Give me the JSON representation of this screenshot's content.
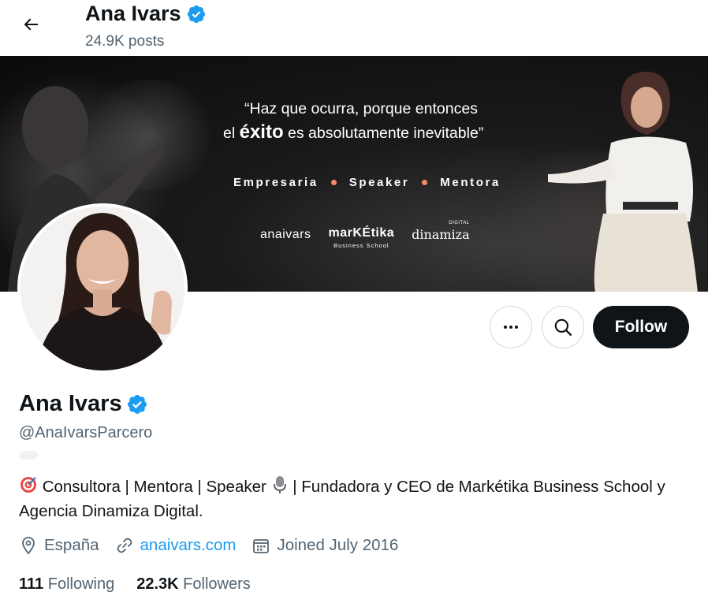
{
  "header": {
    "name": "Ana Ivars",
    "posts_count": "24.9K posts"
  },
  "banner": {
    "quote_line1": "“Haz que ocurra, porque entonces",
    "quote_line2_pre": "el ",
    "quote_line2_bold": "éxito",
    "quote_line2_post": " es absolutamente inevitable”",
    "roles": [
      "Empresaria",
      "Speaker",
      "Mentora"
    ],
    "logo_1": "anaivars",
    "logo_2": "marKÉtika",
    "logo_2_sub": "Business School",
    "logo_3": "dinamiza",
    "logo_3_sup": "DIGITAL"
  },
  "actions": {
    "follow_label": "Follow"
  },
  "profile": {
    "name": "Ana Ivars",
    "handle": "@AnaIvarsParcero",
    "bio_part1": "Consultora | Mentora | Speaker",
    "bio_part2": "| Fundadora y CEO de Markétika Business School y Agencia Dinamiza Digital.",
    "location": "España",
    "website": "anaivars.com",
    "joined": "Joined July 2016",
    "following_count": "111",
    "following_label": "Following",
    "followers_count": "22.3K",
    "followers_label": "Followers"
  },
  "colors": {
    "accent": "#1d9bf0",
    "verified": "#1d9bf0",
    "follow_bg": "#0f1419",
    "muted": "#536471"
  },
  "icons": [
    "back-arrow-icon",
    "verified-badge-icon",
    "more-icon",
    "search-icon",
    "target-emoji-icon",
    "microphone-emoji-icon",
    "location-icon",
    "link-icon",
    "calendar-icon"
  ]
}
